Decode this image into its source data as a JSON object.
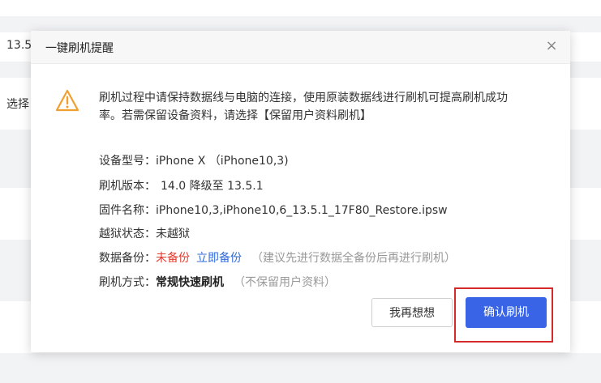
{
  "background": {
    "row1_text": "13.5",
    "row2_text": "选择"
  },
  "dialog": {
    "title": "一键刷机提醒",
    "close_glyph": "×",
    "warning_icon": "warning-triangle-icon",
    "warning_line1": "刷机过程中请保持数据线与电脑的连接，使用原装数据线进行刷机可提高刷机成功",
    "warning_line2": "率。若需保留设备资料，请选择【保留用户资料刷机】",
    "device_model_label": "设备型号：",
    "device_model_value": "iPhone X （iPhone10,3)",
    "flash_version_label": "刷机版本：",
    "flash_version_value": "14.0 降级至 13.5.1",
    "firmware_label": "固件名称：",
    "firmware_value": "iPhone10,3,iPhone10,6_13.5.1_17F80_Restore.ipsw",
    "jailbreak_label": "越狱状态：",
    "jailbreak_value": "未越狱",
    "backup_label": "数据备份：",
    "backup_status": "未备份",
    "backup_link": "立即备份",
    "backup_hint": "（建议先进行数据全备份后再进行刷机）",
    "flash_mode_label": "刷机方式：",
    "flash_mode_value": "常规快速刷机",
    "flash_mode_hint": "（不保留用户资料）",
    "cancel_button": "我再想想",
    "confirm_button": "确认刷机"
  },
  "colors": {
    "accent": "#3a64e6",
    "link": "#2f6bd8",
    "warning": "#f0a030",
    "danger": "#e33b2e",
    "highlight": "#d42a2a"
  }
}
